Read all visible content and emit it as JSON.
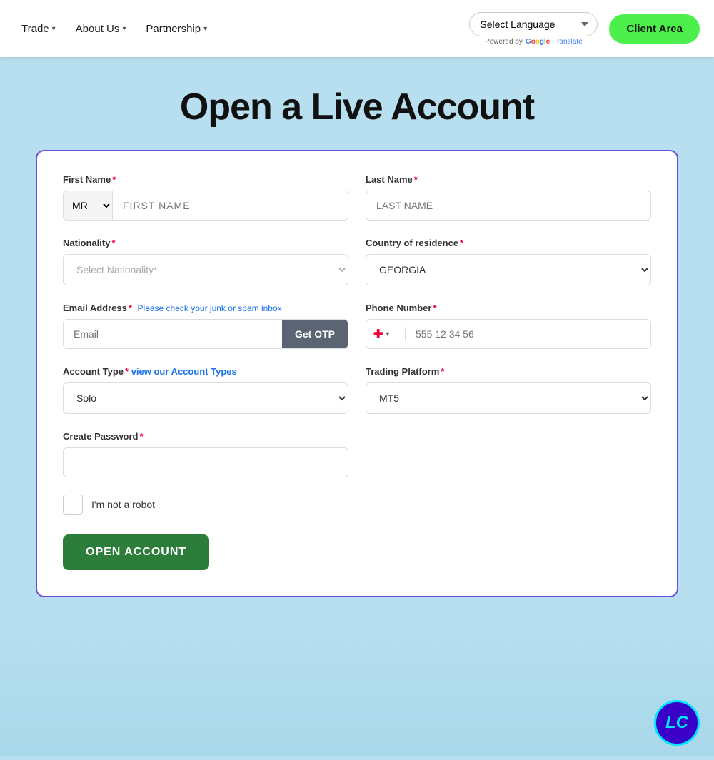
{
  "navbar": {
    "trade_label": "Trade",
    "about_label": "About Us",
    "partnership_label": "Partnership",
    "lang_select_placeholder": "Select Language",
    "powered_by": "Powered by",
    "translate_label": "Translate",
    "client_area_label": "Client Area"
  },
  "page": {
    "title": "Open a Live Account"
  },
  "form": {
    "first_name_label": "First Name",
    "last_name_label": "Last Name",
    "title_default": "MR",
    "first_name_placeholder": "FIRST NAME",
    "last_name_placeholder": "LAST NAME",
    "nationality_label": "Nationality",
    "nationality_placeholder": "Select Nationality*",
    "country_label": "Country of residence",
    "country_value": "GEORGIA",
    "email_label": "Email Address",
    "email_note": "Please check your junk or spam inbox",
    "email_placeholder": "Email",
    "get_otp_label": "Get OTP",
    "phone_label": "Phone Number",
    "phone_placeholder": "555 12 34 56",
    "account_type_label": "Account Type",
    "account_type_note": "view our Account Types",
    "account_type_value": "Solo",
    "trading_platform_label": "Trading Platform",
    "trading_platform_value": "MT5",
    "password_label": "Create Password",
    "recaptcha_label": "I'm not a robot",
    "open_account_label": "OPEN ACCOUNT"
  },
  "badge": {
    "text": "LC"
  }
}
